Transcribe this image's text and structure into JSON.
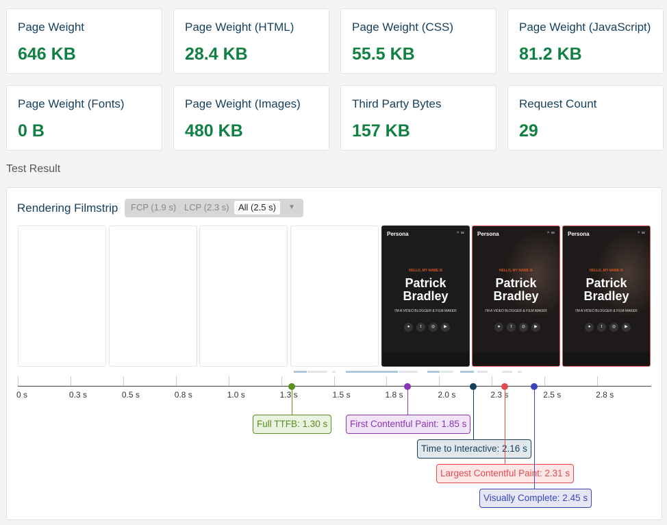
{
  "metrics": [
    {
      "label": "Page Weight",
      "value": "646 KB"
    },
    {
      "label": "Page Weight (HTML)",
      "value": "28.4 KB"
    },
    {
      "label": "Page Weight (CSS)",
      "value": "55.5 KB"
    },
    {
      "label": "Page Weight (JavaScript)",
      "value": "81.2 KB"
    },
    {
      "label": "Page Weight (Fonts)",
      "value": "0 B"
    },
    {
      "label": "Page Weight (Images)",
      "value": "480 KB"
    },
    {
      "label": "Third Party Bytes",
      "value": "157 KB"
    },
    {
      "label": "Request Count",
      "value": "29"
    }
  ],
  "section_title": "Test Result",
  "filmstrip": {
    "title": "Rendering Filmstrip",
    "options": [
      "FCP (1.9 s)",
      "LCP (2.3 s)",
      "All (2.5 s)"
    ],
    "selected": "All (2.5 s)",
    "frame_content": {
      "brand": "Persona",
      "hello": "HELLO, MY NAME IS",
      "name_line1": "Patrick",
      "name_line2": "Bradley",
      "subtitle": "I'M A VIDEO BLOGGER & FILM MAKER"
    },
    "axis_ticks": [
      "0 s",
      "0.3 s",
      "0.5 s",
      "0.8 s",
      "1.0 s",
      "1.3 s",
      "1.5 s",
      "1.8 s",
      "2.0 s",
      "2.3 s",
      "2.5 s",
      "2.8 s"
    ],
    "markers": [
      {
        "label": "Full TTFB: 1.30 s",
        "time": 1.3,
        "color": "#5a8f1d",
        "bg": "#eaf2e1"
      },
      {
        "label": "First Contentful Paint: 1.85 s",
        "time": 1.85,
        "color": "#8a35b5",
        "bg": "#f1e4f7"
      },
      {
        "label": "Time to Interactive: 2.16 s",
        "time": 2.16,
        "color": "#163f5a",
        "bg": "#e0e8ee"
      },
      {
        "label": "Largest Contentful Paint: 2.31 s",
        "time": 2.31,
        "color": "#e24c4c",
        "bg": "#fde6e6"
      },
      {
        "label": "Visually Complete: 2.45 s",
        "time": 2.45,
        "color": "#3b45b8",
        "bg": "#e5e7f7"
      }
    ]
  }
}
